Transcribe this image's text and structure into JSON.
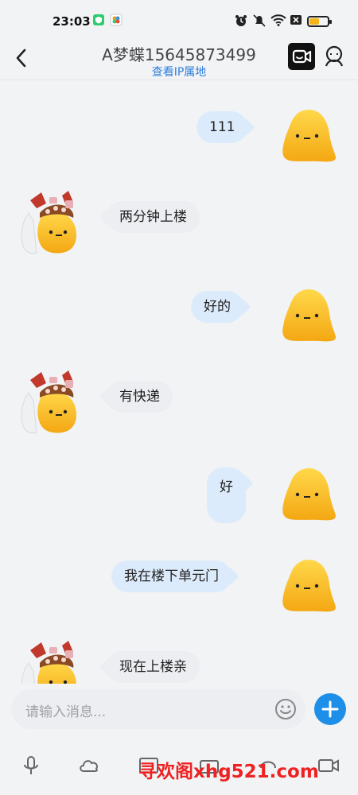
{
  "status_bar": {
    "time": "23:03"
  },
  "header": {
    "title": "A梦蝶15645873499",
    "subtitle": "查看IP属地"
  },
  "messages": [
    {
      "side": "sent",
      "text": "111"
    },
    {
      "side": "received",
      "text": "两分钟上楼"
    },
    {
      "side": "sent",
      "text": "好的"
    },
    {
      "side": "received",
      "text": "有快递"
    },
    {
      "side": "sent",
      "text": "好"
    },
    {
      "side": "sent",
      "text": "我在楼下单元门"
    },
    {
      "side": "received",
      "text": "现在上楼亲"
    }
  ],
  "input": {
    "placeholder": "请输入消息..."
  },
  "watermark": "寻欢阁xhg521.com",
  "colors": {
    "sent_bubble": "#dcebfb",
    "received_bubble": "#eceef1",
    "accent": "#1e8fe8",
    "link": "#2d7fdc",
    "avatar_yellow": "#f6c11c"
  },
  "icons": {
    "back": "chevron-left-icon",
    "video_call": "video-camera-icon",
    "profile": "person-icon",
    "emoji": "smiley-icon",
    "plus": "plus-icon",
    "voice": "microphone-icon",
    "cloud": "cloud-icon",
    "video": "gif-video-icon"
  }
}
